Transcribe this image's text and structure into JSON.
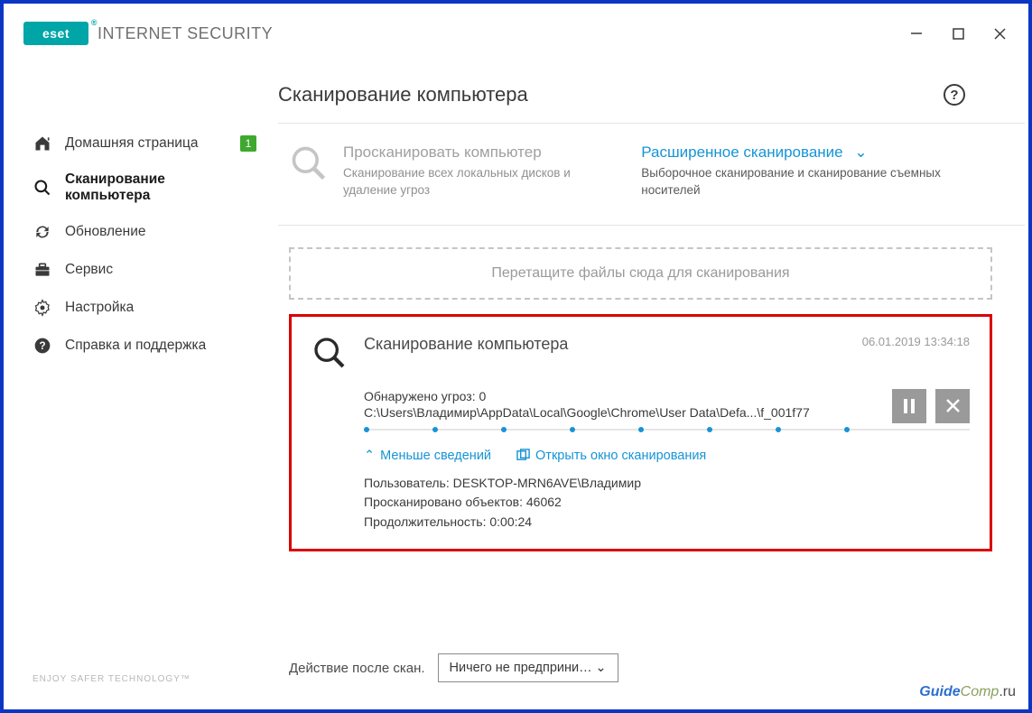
{
  "app": {
    "logo_text": "eset",
    "product_name": "INTERNET SECURITY",
    "tagline": "ENJOY SAFER TECHNOLOGY™"
  },
  "window_controls": {
    "minimize": "–",
    "maximize": "□",
    "close": "✕"
  },
  "sidebar": {
    "items": [
      {
        "label": "Домашняя страница",
        "badge": "1"
      },
      {
        "label": "Сканирование компьютера"
      },
      {
        "label": "Обновление"
      },
      {
        "label": "Сервис"
      },
      {
        "label": "Настройка"
      },
      {
        "label": "Справка и поддержка"
      }
    ]
  },
  "main": {
    "title": "Сканирование компьютера",
    "help": "?",
    "scan_option": {
      "title": "Просканировать компьютер",
      "subtitle": "Сканирование всех локальных дисков и удаление угроз"
    },
    "advanced_option": {
      "title": "Расширенное сканирование",
      "subtitle": "Выборочное сканирование и сканирование съемных носителей"
    },
    "dropzone": "Перетащите файлы сюда для сканирования",
    "scan": {
      "title": "Сканирование компьютера",
      "timestamp": "06.01.2019 13:34:18",
      "threats_label": "Обнаружено угроз: 0",
      "path": "C:\\Users\\Владимир\\AppData\\Local\\Google\\Chrome\\User Data\\Defa...\\f_001f77",
      "less_details": "Меньше сведений",
      "open_window": "Открыть окно сканирования",
      "user_line": "Пользователь: DESKTOP-MRN6AVE\\Владимир",
      "objects_line": "Просканировано объектов: 46062",
      "duration_line": "Продолжительность: 0:00:24",
      "pause": "❚❚",
      "stop": "✕"
    },
    "footer": {
      "label": "Действие после скан.",
      "dropdown_value": "Ничего не предприни…",
      "chevron": "⌄"
    }
  },
  "watermark": {
    "a": "Guide",
    "b": "Comp",
    "c": ".ru"
  }
}
